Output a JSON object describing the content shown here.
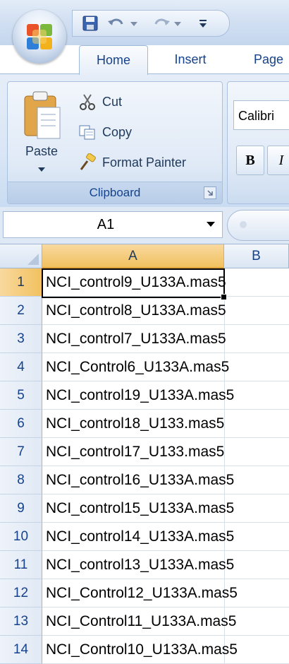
{
  "ribbon": {
    "tabs": [
      "Home",
      "Insert",
      "Page"
    ],
    "clipboard": {
      "paste_label": "Paste",
      "cut_label": "Cut",
      "copy_label": "Copy",
      "format_painter_label": "Format Painter",
      "group_label": "Clipboard"
    },
    "font": {
      "font_name": "Calibri",
      "bold_label": "B",
      "italic_label": "I"
    }
  },
  "formula_bar": {
    "name_box": "A1"
  },
  "sheet": {
    "columns": [
      "A",
      "B"
    ],
    "active_cell": "A1",
    "rows": [
      {
        "num": "1",
        "a": "NCI_control9_U133A.mas5"
      },
      {
        "num": "2",
        "a": "NCI_control8_U133A.mas5"
      },
      {
        "num": "3",
        "a": "NCI_control7_U133A.mas5"
      },
      {
        "num": "4",
        "a": "NCI_Control6_U133A.mas5"
      },
      {
        "num": "5",
        "a": "NCI_control19_U133A.mas5"
      },
      {
        "num": "6",
        "a": "NCI_control18_U133.mas5"
      },
      {
        "num": "7",
        "a": "NCI_control17_U133.mas5"
      },
      {
        "num": "8",
        "a": "NCI_control16_U133A.mas5"
      },
      {
        "num": "9",
        "a": "NCI_control15_U133A.mas5"
      },
      {
        "num": "10",
        "a": "NCI_control14_U133A.mas5"
      },
      {
        "num": "11",
        "a": "NCI_control13_U133A.mas5"
      },
      {
        "num": "12",
        "a": "NCI_Control12_U133A.mas5"
      },
      {
        "num": "13",
        "a": "NCI_Control11_U133A.mas5"
      },
      {
        "num": "14",
        "a": "NCI_Control10_U133A.mas5"
      }
    ]
  }
}
